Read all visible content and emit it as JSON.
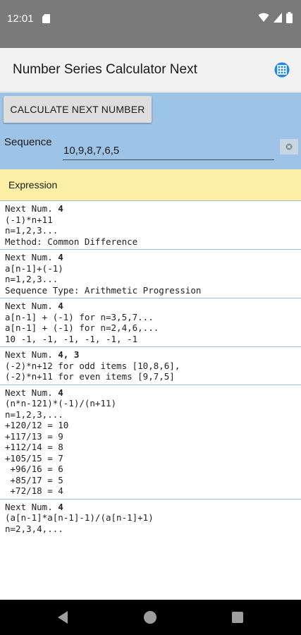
{
  "status_bar": {
    "time": "12:01",
    "icons": [
      "sd-card-icon",
      "wifi-icon",
      "signal-icon",
      "battery-icon"
    ]
  },
  "app_bar": {
    "title": "Number Series Calculator Next",
    "action_icon": "grid-icon",
    "accent_color": "#1e88e5"
  },
  "input_panel": {
    "calculate_label": "CALCULATE NEXT NUMBER",
    "sequence_label": "Sequence",
    "sequence_value": "10,9,8,7,6,5",
    "clear_icon": "clear-icon",
    "background_color": "#9dc3e6"
  },
  "expression_header": {
    "label": "Expression",
    "background_color": "#fdf0a6"
  },
  "results": [
    {
      "prefix": "Next Num. ",
      "value": "4",
      "lines": [
        "(-1)*n+11",
        "n=1,2,3...",
        "Method: Common Difference"
      ]
    },
    {
      "prefix": "Next Num. ",
      "value": "4",
      "lines": [
        "a[n-1]+(-1)",
        "n=1,2,3...",
        "Sequence Type: Arithmetic Progression"
      ]
    },
    {
      "prefix": "Next Num. ",
      "value": "4",
      "lines": [
        "a[n-1] + (-1) for n=3,5,7...",
        "a[n-1] + (-1) for n=2,4,6,...",
        "10 -1, -1, -1, -1, -1, -1"
      ]
    },
    {
      "prefix": "Next Num. ",
      "value": "4, 3",
      "lines": [
        "(-2)*n+12 for odd items [10,8,6],",
        "(-2)*n+11 for even items [9,7,5]"
      ]
    },
    {
      "prefix": "Next Num. ",
      "value": "4",
      "lines": [
        "(n*n-121)*(-1)/(n+11)",
        "n=1,2,3,...",
        "+120/12 = 10",
        "+117/13 = 9",
        "+112/14 = 8",
        "+105/15 = 7",
        " +96/16 = 6",
        " +85/17 = 5",
        " +72/18 = 4"
      ]
    },
    {
      "prefix": "Next Num. ",
      "value": "4",
      "lines": [
        "(a[n-1]*a[n-1]-1)/(a[n-1]+1)",
        "n=2,3,4,..."
      ]
    }
  ],
  "nav_bar": {
    "icons": [
      "back-icon",
      "home-icon",
      "recents-icon"
    ]
  }
}
